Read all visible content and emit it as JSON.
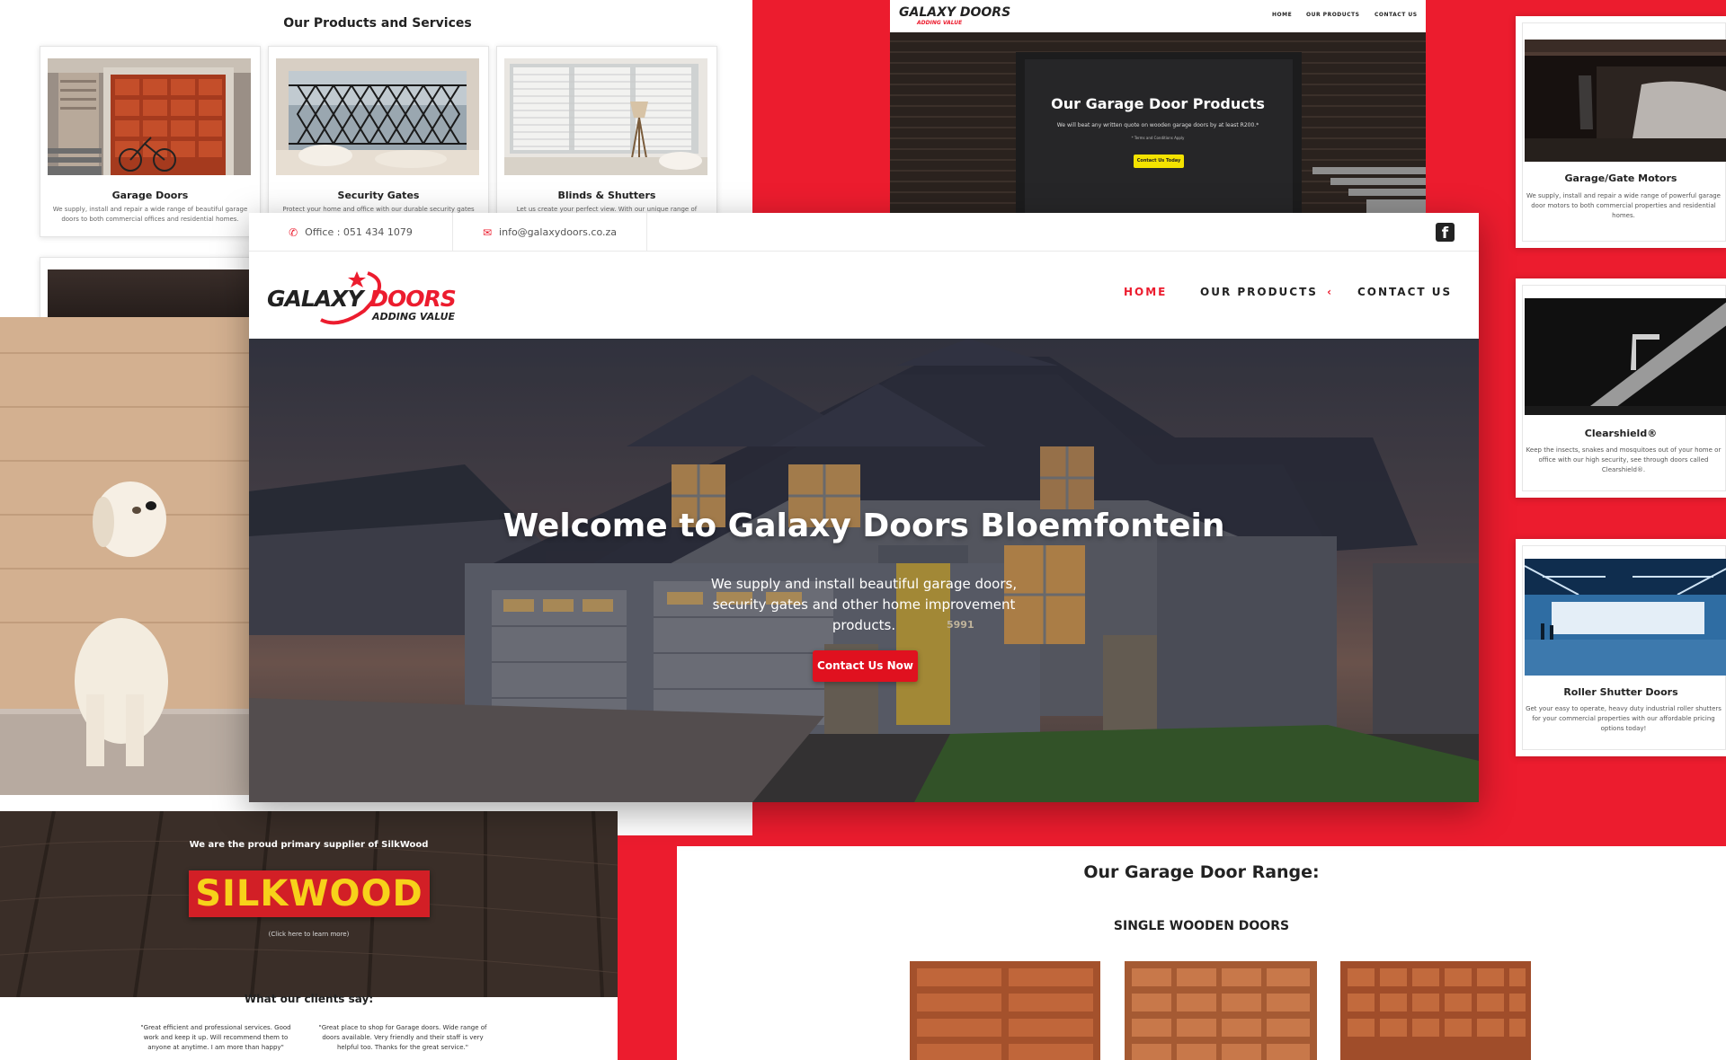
{
  "services_panel": {
    "title": "Our Products and Services",
    "cards": [
      {
        "name": "Garage Doors",
        "desc": "We supply, install and repair a wide range of beautiful garage doors to both commercial offices and residential homes."
      },
      {
        "name": "Security Gates",
        "desc": "Protect your home and office with our durable security gates"
      },
      {
        "name": "Blinds & Shutters",
        "desc": "Let us create your perfect view. With our unique range of"
      }
    ]
  },
  "garage_products_panel": {
    "logo_main": "GALAXY DOORS",
    "logo_tag": "ADDING VALUE",
    "nav": [
      "HOME",
      "OUR PRODUCTS",
      "CONTACT US"
    ],
    "title": "Our Garage Door Products",
    "subtitle": "We will beat any written quote on wooden garage doors by at least R200.*",
    "note": "* Terms and Conditions Apply",
    "button": "Contact Us Today"
  },
  "product_column": [
    {
      "name": "Garage/Gate Motors",
      "desc": "We supply, install and repair a wide range of powerful garage door motors to both commercial properties and residential homes."
    },
    {
      "name": "Clearshield®",
      "desc": "Keep the insects, snakes and mosquitoes out of your home or office with our high security, see through doors called Clearshield®."
    },
    {
      "name": "Roller Shutter Doors",
      "desc": "Get your easy to operate, heavy duty industrial roller shutters for your commercial properties with our affordable pricing options today!"
    }
  ],
  "silkwood": {
    "heading": "We are the proud primary supplier of SilkWood",
    "logo": "SILKWOOD",
    "link": "(Click here to learn more)"
  },
  "testimonials": {
    "title": "What our clients say:",
    "quotes": [
      "\"Great efficient and professional services. Good work and keep it up. Will recommend them to anyone at anytime. I am more than happy\"",
      "\"Great place to shop for Garage doors. Wide range of doors available. Very friendly and their staff is very helpful too. Thanks for the great service.\""
    ]
  },
  "range": {
    "title": "Our Garage Door Range:",
    "subtitle": "SINGLE WOODEN DOORS"
  },
  "main": {
    "topbar": {
      "phone": "Office : 051 434 1079",
      "email": "info@galaxydoors.co.za"
    },
    "logo_main": "GALAXY DOORS",
    "logo_word1": "GALAXY",
    "logo_word2": "DOORS",
    "logo_tag": "ADDING VALUE",
    "nav": {
      "home": "HOME",
      "products": "OUR PRODUCTS",
      "contact": "CONTACT US",
      "chevron": "‹"
    },
    "hero": {
      "title": "Welcome to Galaxy Doors Bloemfontein",
      "subtitle": "We supply and install beautiful garage doors, security gates and other home improvement products.",
      "button": "Contact Us Now",
      "house_number": "5991"
    }
  },
  "colors": {
    "brand_red": "#ec1c2e",
    "button_yellow": "#f4e300",
    "silkwood_yellow": "#f7d21a"
  }
}
